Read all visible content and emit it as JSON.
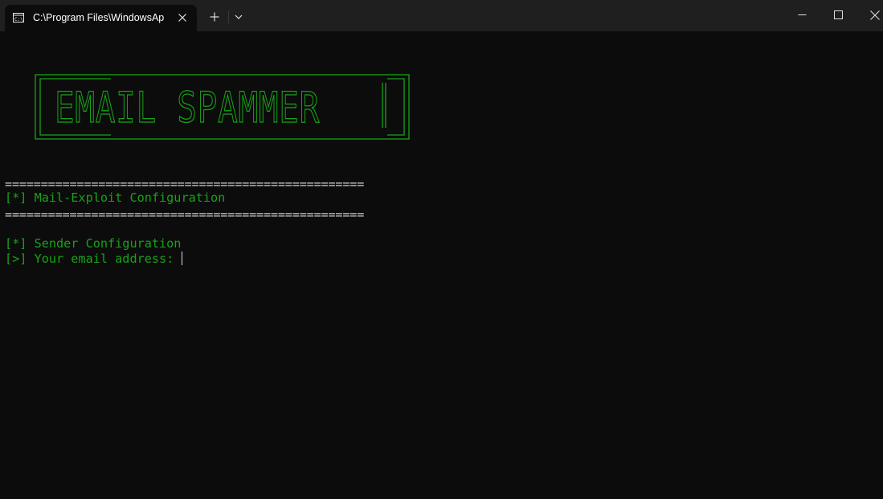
{
  "titlebar": {
    "tab_title": "C:\\Program Files\\WindowsAp",
    "tab_icon": "terminal-icon"
  },
  "banner": {
    "text": "EMAIL SPAMMER"
  },
  "terminal": {
    "separator": "==================================================",
    "header_line": "[*] Mail-Exploit Configuration",
    "section_line": "[*] Sender Configuration",
    "prompt_line": "[>] Your email address: ",
    "input_value": ""
  },
  "colors": {
    "text_green": "#16a316",
    "background": "#0c0c0c",
    "titlebar": "#1f1f1f",
    "separator_text": "#cccccc"
  }
}
